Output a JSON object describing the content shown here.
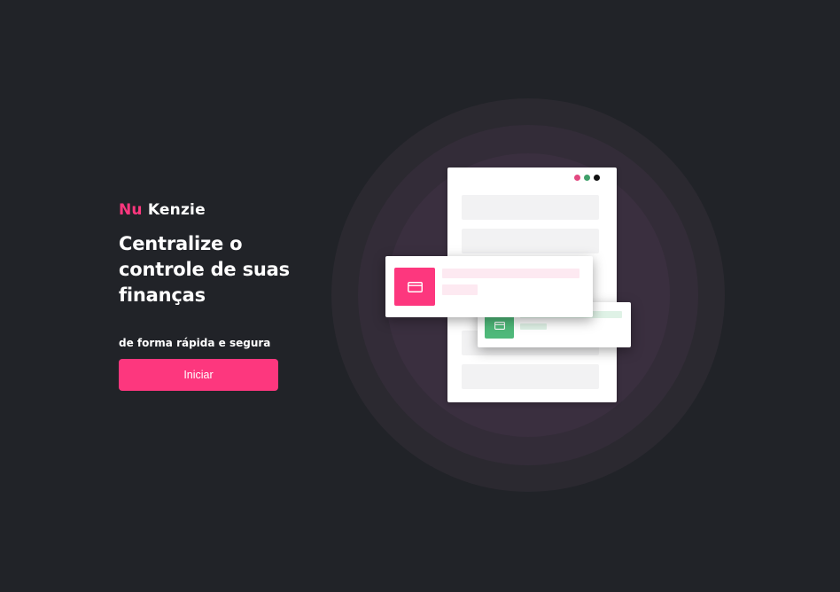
{
  "logo": {
    "nu": "Nu",
    "kenzie": "Kenzie"
  },
  "hero": {
    "headline": "Centralize o controle de suas finanças",
    "tagline": "de forma rápida e segura",
    "start_button_label": "Iniciar"
  },
  "illustration": {
    "window_dots": [
      {
        "icon": "window-dot-icon",
        "color": "#e34981"
      },
      {
        "icon": "window-dot-icon",
        "color": "#3fa06a"
      },
      {
        "icon": "window-dot-icon",
        "color": "#111111"
      }
    ],
    "transaction_cards": [
      {
        "icon": "credit-card-icon",
        "color": "#fd377e",
        "line_color": "#fde9f1"
      },
      {
        "icon": "credit-card-icon",
        "color": "#4fb97a",
        "line_color": "#dff2e6"
      }
    ]
  },
  "colors": {
    "background": "#212328",
    "accent": "#fd377e",
    "text": "#ffffff"
  }
}
